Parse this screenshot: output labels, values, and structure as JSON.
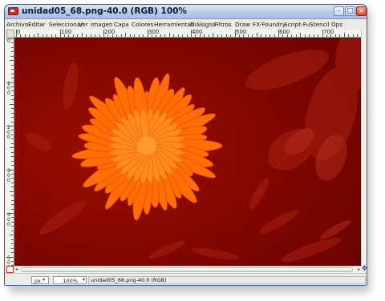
{
  "window": {
    "title": "unidad05_68.png-40.0 (RGB) 100%"
  },
  "menubar": {
    "items": [
      "Archivo",
      "Editar",
      "Seleccionar",
      "Ver",
      "Imagen",
      "Capa",
      "Colores",
      "Herramientas",
      "Diálogos",
      "Filtros",
      "Draw",
      "FX-Foundry",
      "Script-Fu",
      "Stencil Ops"
    ]
  },
  "ruler": {
    "horizontal_labels": [
      "0",
      "100",
      "200",
      "300",
      "400",
      "500",
      "600",
      "700"
    ],
    "vertical_labels": [
      "0",
      "100",
      "200",
      "300",
      "400",
      "500"
    ]
  },
  "canvas": {
    "description_icon": "image-canvas",
    "background_color": "#8c0900",
    "flower_color": "#ff6a00"
  },
  "statusbar": {
    "unit": "px",
    "zoom": "100%",
    "status_text": "unidad05_68.png-40.0 (RGB)"
  },
  "colors": {
    "quick_mask_border": "#c3301e",
    "title_gradient_top": "#d9e6f7",
    "close_button": "#d44a2c"
  },
  "icons": {
    "app": "gimp-app-icon",
    "minimize": "minimize-icon",
    "maximize": "maximize-icon",
    "close": "close-icon",
    "navigate": "navigate-icon",
    "quick_mask": "quick-mask-icon",
    "dropdown": "chevron-down-icon"
  }
}
